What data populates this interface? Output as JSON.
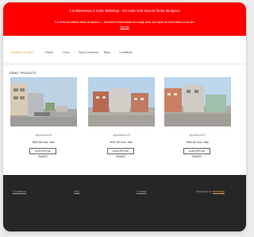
{
  "banner": {
    "line1": "1 & Bienvenue à notre Webshop - les mots sont sous la forme de lignes",
    "line2": "Ce texte est illisible dans la capture — bannière d'information en rouge avec une ligne de texte blanc et un lien",
    "link": "Fermer"
  },
  "nav": {
    "items": [
      "Boutique en ligne",
      "Panier",
      "Liens",
      "Nous Contacter",
      "Blog",
      "Conditions"
    ]
  },
  "section_title": "DÉMO: PRODUITS",
  "products": [
    {
      "name": "Appartement A",
      "price": "€89,00 incl. btw",
      "button": "AJOUTER AU PANIER"
    },
    {
      "name": "Appartement B",
      "price": "€97,00 incl. btw",
      "button": "AJOUTER AU PANIER"
    },
    {
      "name": "Appartement C",
      "price": "€89,00 incl. btw",
      "button": "AJOUTER AU PANIER"
    }
  ],
  "footer": {
    "links": [
      "Conditions",
      "FAQ",
      "Contact"
    ],
    "credit_prefix": "Webshop by",
    "credit_link": "Webshop"
  },
  "colors": {
    "banner": "#ff0000",
    "accent": "#e8a33a",
    "footer": "#262626"
  }
}
